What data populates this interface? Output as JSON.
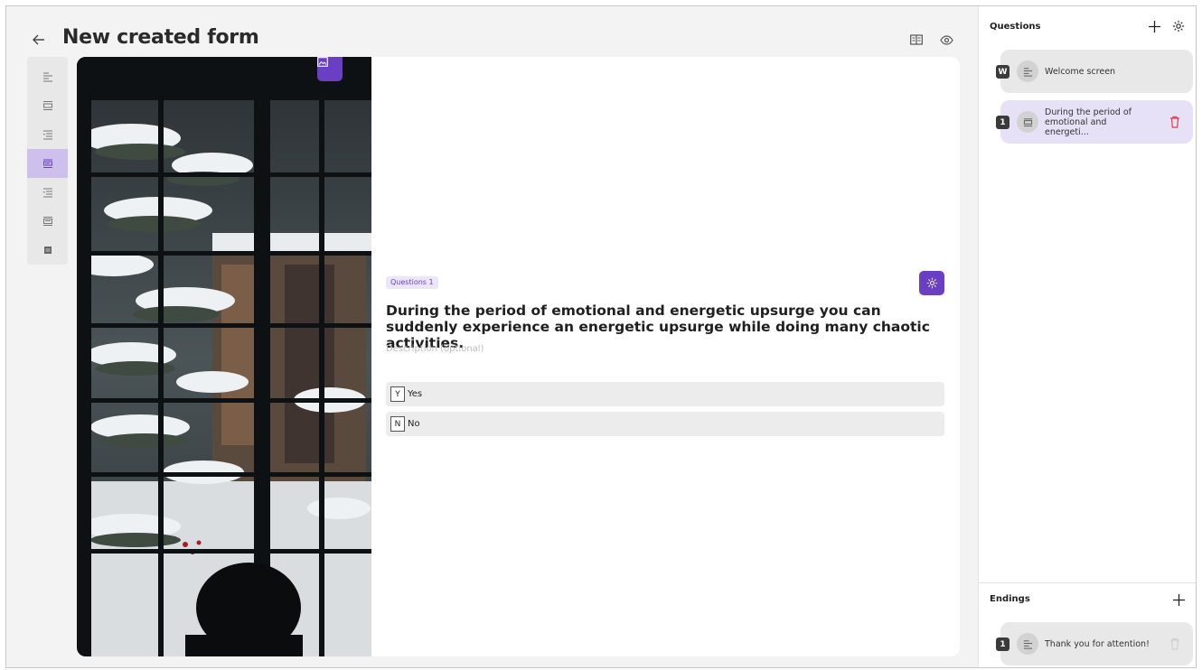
{
  "header": {
    "title": "New created form",
    "back_icon": "arrow-left-icon",
    "tools": [
      "book-icon",
      "eye-icon"
    ]
  },
  "toolbar": {
    "items": [
      "text-icon",
      "title-block-icon",
      "indent-list-icon",
      "short-text-icon",
      "indent-list-icon",
      "long-text-icon",
      "block-icon"
    ],
    "active_index": 3
  },
  "question": {
    "badge": "Questions 1",
    "title": "During the period of emotional and energetic upsurge you can suddenly experience an energetic upsurge while doing many chaotic activities.",
    "description_placeholder": "Description (optional)",
    "options": [
      {
        "key": "Y",
        "label": "Yes"
      },
      {
        "key": "N",
        "label": "No"
      }
    ]
  },
  "sidebar": {
    "questions_heading": "Questions",
    "endings_heading": "Endings",
    "questions": [
      {
        "tag": "W",
        "label": "Welcome screen"
      },
      {
        "tag": "1",
        "label": "During the period of emotional and energeti..."
      }
    ],
    "endings": [
      {
        "tag": "1",
        "label": "Thank you for attention!"
      }
    ]
  },
  "colors": {
    "accent": "#6b3fc4",
    "accent_light": "#e7e1f7",
    "delete": "#e03a4a"
  }
}
